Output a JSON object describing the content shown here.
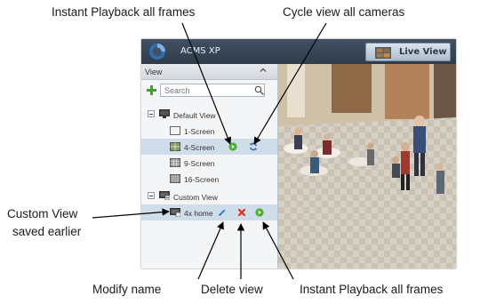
{
  "callouts": {
    "instant_playback_top": "Instant Playback all frames",
    "cycle_view": "Cycle view all cameras",
    "custom_view_line1": "Custom View",
    "custom_view_line2": "saved earlier",
    "modify_name": "Modify name",
    "delete_view": "Delete view",
    "instant_playback_bottom": "Instant Playback all frames"
  },
  "app": {
    "title": "ACMS XP",
    "live_view_label": "Live View"
  },
  "panel": {
    "title": "View",
    "search_placeholder": "Search"
  },
  "tree": {
    "default_group": "Default View",
    "items": [
      "1-Screen",
      "4-Screen",
      "9-Screen",
      "16-Screen"
    ],
    "custom_group": "Custom View",
    "custom_items": [
      "4x home"
    ]
  },
  "colors": {
    "accent_blue": "#2d6fb0",
    "playback_green": "#4caf2e",
    "delete_red": "#e0301e",
    "edit_blue": "#3a86d6"
  },
  "icons": {
    "playback": "play-circle-icon",
    "cycle": "cycle-arrows-icon",
    "delete": "x-icon",
    "modify": "pencil-icon"
  }
}
